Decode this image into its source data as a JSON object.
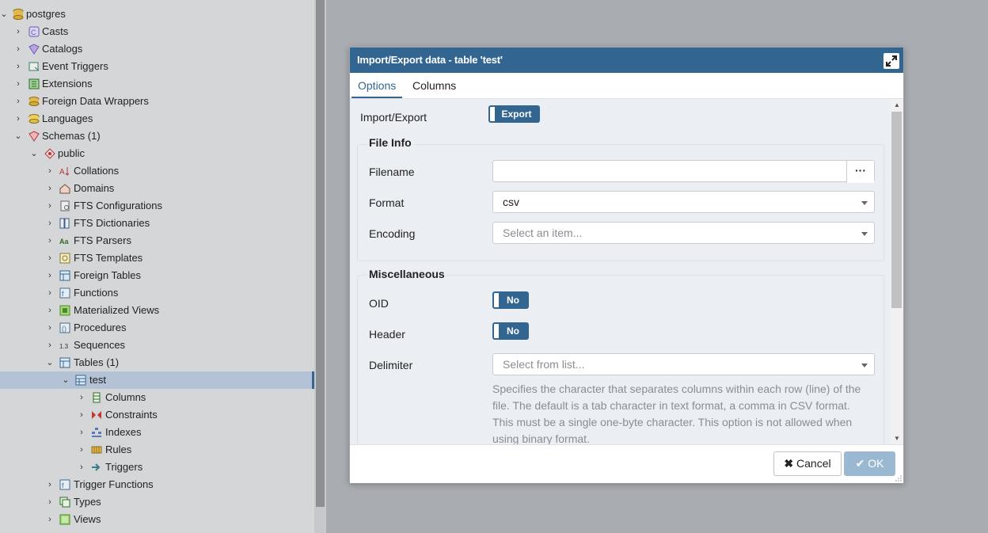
{
  "tree": {
    "items": [
      {
        "label": "postgres",
        "icon": "database-icon",
        "expanded": true
      },
      {
        "label": "Casts",
        "icon": "cast-icon",
        "expanded": false
      },
      {
        "label": "Catalogs",
        "icon": "catalog-icon",
        "expanded": false
      },
      {
        "label": "Event Triggers",
        "icon": "event-trigger-icon",
        "expanded": false
      },
      {
        "label": "Extensions",
        "icon": "extension-icon",
        "expanded": false
      },
      {
        "label": "Foreign Data Wrappers",
        "icon": "foreign-data-wrapper-icon",
        "expanded": false
      },
      {
        "label": "Languages",
        "icon": "language-icon",
        "expanded": false
      },
      {
        "label": "Schemas (1)",
        "icon": "schemas-icon",
        "expanded": true
      },
      {
        "label": "public",
        "icon": "schema-icon",
        "expanded": true
      },
      {
        "label": "Collations",
        "icon": "collation-icon",
        "expanded": false
      },
      {
        "label": "Domains",
        "icon": "domain-icon",
        "expanded": false
      },
      {
        "label": "FTS Configurations",
        "icon": "fts-configuration-icon",
        "expanded": false
      },
      {
        "label": "FTS Dictionaries",
        "icon": "fts-dictionary-icon",
        "expanded": false
      },
      {
        "label": "FTS Parsers",
        "icon": "fts-parser-icon",
        "expanded": false
      },
      {
        "label": "FTS Templates",
        "icon": "fts-template-icon",
        "expanded": false
      },
      {
        "label": "Foreign Tables",
        "icon": "foreign-table-icon",
        "expanded": false
      },
      {
        "label": "Functions",
        "icon": "function-icon",
        "expanded": false
      },
      {
        "label": "Materialized Views",
        "icon": "materialized-view-icon",
        "expanded": false
      },
      {
        "label": "Procedures",
        "icon": "procedure-icon",
        "expanded": false
      },
      {
        "label": "Sequences",
        "icon": "sequence-icon",
        "expanded": false
      },
      {
        "label": "Tables (1)",
        "icon": "tables-icon",
        "expanded": true
      },
      {
        "label": "test",
        "icon": "table-icon",
        "expanded": true,
        "selected": true
      },
      {
        "label": "Columns",
        "icon": "columns-icon",
        "expanded": false
      },
      {
        "label": "Constraints",
        "icon": "constraints-icon",
        "expanded": false
      },
      {
        "label": "Indexes",
        "icon": "indexes-icon",
        "expanded": false
      },
      {
        "label": "Rules",
        "icon": "rules-icon",
        "expanded": false
      },
      {
        "label": "Triggers",
        "icon": "triggers-icon",
        "expanded": false
      },
      {
        "label": "Trigger Functions",
        "icon": "trigger-function-icon",
        "expanded": false
      },
      {
        "label": "Types",
        "icon": "type-icon",
        "expanded": false
      },
      {
        "label": "Views",
        "icon": "view-icon",
        "expanded": false
      }
    ]
  },
  "dialog": {
    "title": "Import/Export data - table 'test'",
    "tabs": [
      "Options",
      "Columns"
    ],
    "active_tab": "Options",
    "import_export": {
      "label": "Import/Export",
      "value": "Export"
    },
    "file_info": {
      "legend": "File Info",
      "filename": {
        "label": "Filename",
        "value": "",
        "browse_label": "···"
      },
      "format": {
        "label": "Format",
        "value": "csv"
      },
      "encoding": {
        "label": "Encoding",
        "placeholder": "Select an item..."
      }
    },
    "misc": {
      "legend": "Miscellaneous",
      "oid": {
        "label": "OID",
        "value": "No"
      },
      "header": {
        "label": "Header",
        "value": "No"
      },
      "delimiter": {
        "label": "Delimiter",
        "placeholder": "Select from list...",
        "help": "Specifies the character that separates columns within each row (line) of the file. The default is a tab character in text format, a comma in CSV format. This must be a single one-byte character. This option is not allowed when using binary format."
      }
    },
    "footer": {
      "cancel_label": "Cancel",
      "ok_label": "OK"
    }
  },
  "colors": {
    "accent": "#326690",
    "ok_disabled": "#9ab8d2",
    "tree_bg": "#d5d6d8",
    "selected_row": "#b3c3d5"
  }
}
